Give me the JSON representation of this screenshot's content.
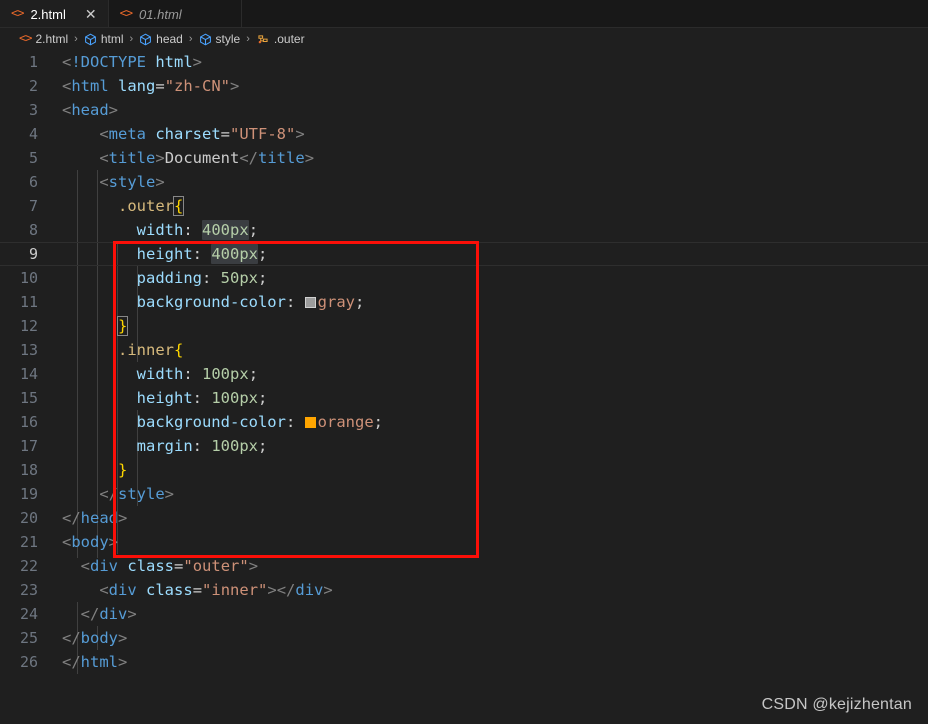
{
  "window": {
    "background_color": "#1f1f1f",
    "tabbar_color": "#181818"
  },
  "tabs": [
    {
      "label": "2.html",
      "icon": "html-code-icon",
      "active": true,
      "close_glyph": "✕"
    },
    {
      "label": "01.html",
      "icon": "html-code-icon",
      "active": false
    }
  ],
  "breadcrumb": {
    "separator": "›",
    "items": [
      {
        "label": "2.html",
        "icon": "html-code-icon"
      },
      {
        "label": "html",
        "icon": "symbol-cube-icon"
      },
      {
        "label": "head",
        "icon": "symbol-cube-icon"
      },
      {
        "label": "style",
        "icon": "symbol-cube-icon"
      },
      {
        "label": ".outer",
        "icon": "symbol-ruler-icon"
      }
    ]
  },
  "editor": {
    "active_line": 9,
    "selection_text": "400px",
    "color_swatches": [
      {
        "line": 11,
        "name": "gray",
        "hex": "#9c9c9c"
      },
      {
        "line": 16,
        "name": "orange",
        "hex": "#ffa500"
      }
    ],
    "line_numbers": [
      1,
      2,
      3,
      4,
      5,
      6,
      7,
      8,
      9,
      10,
      11,
      12,
      13,
      14,
      15,
      16,
      17,
      18,
      19,
      20,
      21,
      22,
      23,
      24,
      25,
      26
    ],
    "lines": [
      {
        "n": 1,
        "text": "<!DOCTYPE html>"
      },
      {
        "n": 2,
        "text": "<html lang=\"zh-CN\">"
      },
      {
        "n": 3,
        "text": "<head>"
      },
      {
        "n": 4,
        "text": "    <meta charset=\"UTF-8\">"
      },
      {
        "n": 5,
        "text": "    <title>Document</title>"
      },
      {
        "n": 6,
        "text": "    <style>"
      },
      {
        "n": 7,
        "text": "      .outer{"
      },
      {
        "n": 8,
        "text": "        width: 400px;"
      },
      {
        "n": 9,
        "text": "        height: 400px;"
      },
      {
        "n": 10,
        "text": "        padding: 50px;"
      },
      {
        "n": 11,
        "text": "        background-color: gray;"
      },
      {
        "n": 12,
        "text": "      }"
      },
      {
        "n": 13,
        "text": "      .inner{"
      },
      {
        "n": 14,
        "text": "        width: 100px;"
      },
      {
        "n": 15,
        "text": "        height: 100px;"
      },
      {
        "n": 16,
        "text": "        background-color: orange;"
      },
      {
        "n": 17,
        "text": "        margin: 100px;"
      },
      {
        "n": 18,
        "text": "      }"
      },
      {
        "n": 19,
        "text": "    </style>"
      },
      {
        "n": 20,
        "text": "</head>"
      },
      {
        "n": 21,
        "text": "<body>"
      },
      {
        "n": 22,
        "text": "  <div class=\"outer\">"
      },
      {
        "n": 23,
        "text": "    <div class=\"inner\"></div>"
      },
      {
        "n": 24,
        "text": "  </div>"
      },
      {
        "n": 25,
        "text": "</body>"
      },
      {
        "n": 26,
        "text": "</html>"
      }
    ]
  },
  "annotation": {
    "shape": "rectangle",
    "color": "#fb0f08",
    "covers_lines": "7-19"
  },
  "watermark": {
    "text": "CSDN @kejizhentan"
  }
}
